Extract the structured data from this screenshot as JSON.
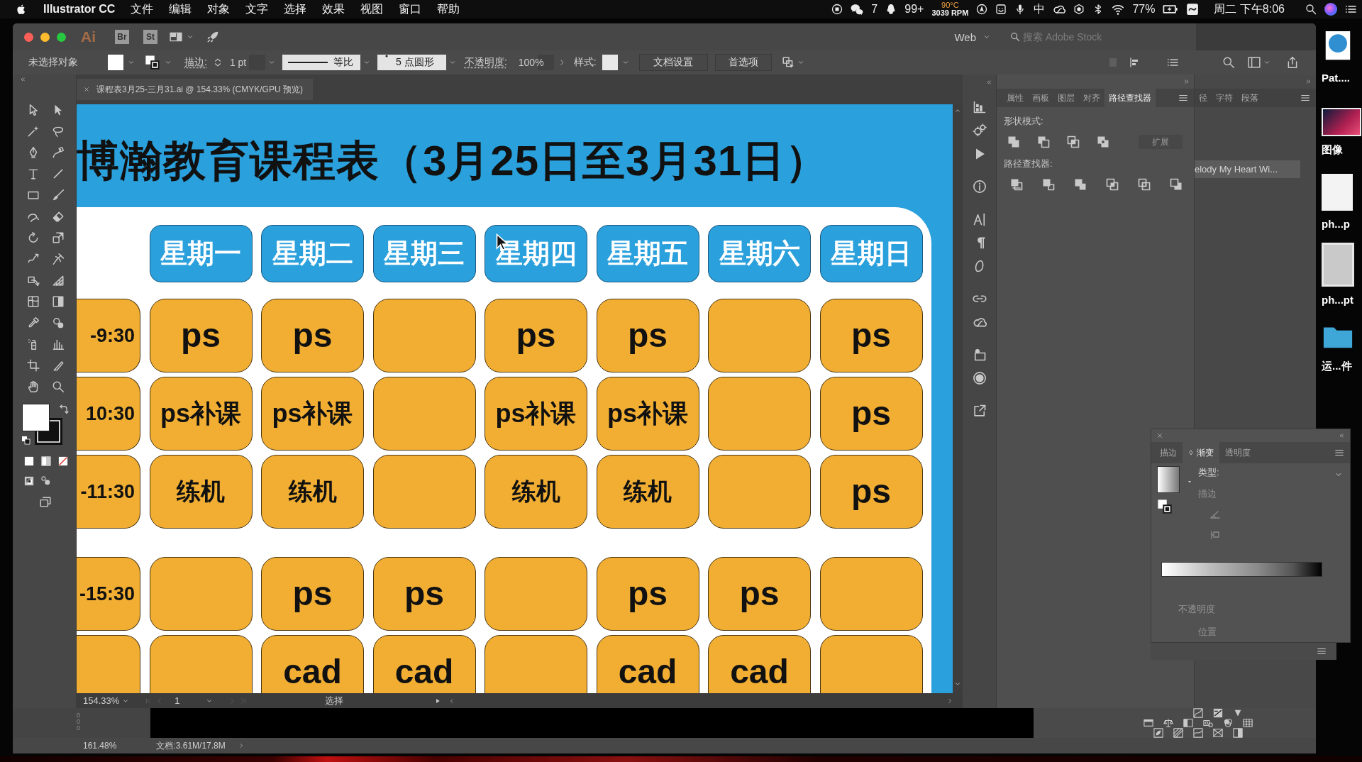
{
  "menu_bar": {
    "app_name": "Illustrator CC",
    "menus": [
      "文件",
      "编辑",
      "对象",
      "文字",
      "选择",
      "效果",
      "视图",
      "窗口",
      "帮助"
    ],
    "chat_badge": "7",
    "notification_badge": "99+",
    "cpu_temperature": "90°C",
    "fan_speed": "3039 RPM",
    "input_method": "中",
    "battery": "77%",
    "clock": "周二 下午8:06"
  },
  "title_bar": {
    "app_logo": "Ai",
    "bridge_button": "Br",
    "stock_button": "St",
    "workspace": "Web",
    "stock_search": {
      "placeholder": "搜索 Adobe Stock"
    }
  },
  "control_bar": {
    "selection": "未选择对象",
    "stroke_label": "描边:",
    "stroke_weight": "1 pt",
    "stroke_profile": "等比",
    "brush": "5 点圆形",
    "opacity_label": "不透明度:",
    "opacity": "100%",
    "style_label": "样式:",
    "buttons": [
      "文档设置",
      "首选项"
    ]
  },
  "document_tab": {
    "title": "课程表3月25-三月31.ai @ 154.33% (CMYK/GPU 预览)"
  },
  "artboard": {
    "title": "博瀚教育课程表（3月25日至3月31日）",
    "days": [
      "星期一",
      "星期二",
      "星期三",
      "星期四",
      "星期五",
      "星期六",
      "星期日"
    ],
    "sections": [
      {
        "rows": [
          {
            "time": "-9:30",
            "cells": [
              "ps",
              "ps",
              null,
              "ps",
              "ps",
              null,
              "ps"
            ]
          },
          {
            "time": "10:30",
            "cells": [
              "ps补课",
              "ps补课",
              null,
              "ps补课",
              "ps补课",
              null,
              "ps"
            ]
          },
          {
            "time": "-11:30",
            "cells": [
              "练机",
              "练机",
              null,
              "练机",
              "练机",
              null,
              "ps"
            ]
          }
        ]
      },
      {
        "rows": [
          {
            "time": "-15:30",
            "cells": [
              null,
              "ps",
              "ps",
              null,
              "ps",
              "ps",
              null
            ]
          },
          {
            "cells": [
              null,
              "cad",
              "cad",
              null,
              "cad",
              "cad",
              null
            ]
          }
        ]
      }
    ]
  },
  "status_bar": {
    "zoom": "154.33%",
    "artboard_number": "1",
    "current_tool": "选择"
  },
  "pathfinder_panel": {
    "tabs": [
      {
        "label": "属性",
        "selected": false
      },
      {
        "label": "画板",
        "selected": false
      },
      {
        "label": "图层",
        "selected": false
      },
      {
        "label": "对齐",
        "selected": false
      },
      {
        "label": "路径查找器",
        "selected": true
      }
    ],
    "shape_modes_label": "形状模式:",
    "expand_button": {
      "label": "扩展",
      "disabled": true
    },
    "pathfinders_label": "路径查找器:"
  },
  "character_panel": {
    "tabs": [
      {
        "label": "径",
        "selected": false
      },
      {
        "label": "字符",
        "selected": false
      },
      {
        "label": "段落",
        "selected": false
      }
    ],
    "font_name": "elody My Heart Wi..."
  },
  "gradient_panel": {
    "tabs": [
      {
        "label": "描边",
        "selected": false
      },
      {
        "label": "渐变",
        "selected": true
      },
      {
        "label": "透明度",
        "selected": false
      }
    ],
    "type_label": "类型:",
    "stroke_label": {
      "text": "描边",
      "disabled": true
    },
    "opacity_label": {
      "text": "不透明度",
      "disabled": true
    },
    "location_label": {
      "text": "位置",
      "disabled": true
    }
  },
  "bottom_panel": {
    "ruler_digits": "000"
  },
  "info_bar": {
    "zoom": "161.48%",
    "document_size": "文档:3.61M/17.8M"
  },
  "desktop_icons": [
    {
      "label": "Pat....",
      "kind": "drive"
    },
    {
      "label": "图像",
      "kind": "image"
    },
    {
      "label": "ph...p",
      "kind": "document"
    },
    {
      "label": "ph...pt",
      "kind": "slides"
    },
    {
      "label": "运...件",
      "kind": "folder"
    }
  ]
}
